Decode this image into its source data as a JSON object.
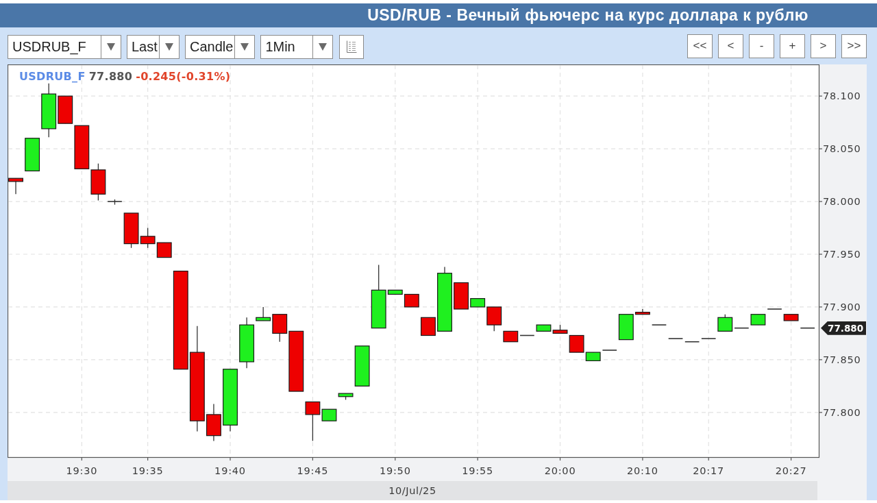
{
  "window": {
    "title": "USD/RUB - Вечный фьючерс на курс доллара к рублю"
  },
  "toolbar": {
    "dropdowns": [
      {
        "value": "USDRUB_F"
      },
      {
        "value": "Last"
      },
      {
        "value": "Candle"
      },
      {
        "value": "1Min"
      }
    ],
    "nav_buttons": [
      "<<",
      "<",
      "-",
      "+",
      ">",
      ">>"
    ]
  },
  "chart": {
    "legend": {
      "symbol": "USDRUB_F",
      "price": "77.880",
      "change": "-0.245(-0.31%)"
    },
    "price_tag": "77.880",
    "chart_data": {
      "type": "candlestick",
      "xlabel": "10/Jul/25",
      "grid": true,
      "categories": [
        null,
        null,
        null,
        null,
        "19:30",
        null,
        null,
        null,
        "19:35",
        null,
        null,
        null,
        null,
        "19:40",
        null,
        null,
        null,
        null,
        "19:45",
        null,
        null,
        null,
        null,
        "19:50",
        null,
        null,
        null,
        null,
        "19:55",
        null,
        null,
        null,
        null,
        "20:00",
        null,
        null,
        null,
        null,
        "20:10",
        null,
        null,
        null,
        "20:17",
        null,
        null,
        null,
        null,
        "20:27",
        null
      ],
      "ohlc": [
        [
          78.022,
          78.022,
          78.007,
          78.019
        ],
        [
          78.029,
          78.06,
          78.029,
          78.06
        ],
        [
          78.069,
          78.112,
          78.061,
          78.102
        ],
        [
          78.1,
          78.1,
          78.074,
          78.074
        ],
        [
          78.072,
          78.072,
          78.031,
          78.031
        ],
        [
          78.03,
          78.036,
          78.001,
          78.007
        ],
        [
          78.0,
          78.002,
          77.997,
          78.0
        ],
        [
          77.989,
          77.989,
          77.956,
          77.96
        ],
        [
          77.967,
          77.975,
          77.956,
          77.96
        ],
        [
          77.961,
          77.961,
          77.947,
          77.947
        ],
        [
          77.934,
          77.934,
          77.841,
          77.841
        ],
        [
          77.857,
          77.882,
          77.782,
          77.792
        ],
        [
          77.798,
          77.808,
          77.773,
          77.778
        ],
        [
          77.788,
          77.841,
          77.782,
          77.841
        ],
        [
          77.848,
          77.89,
          77.842,
          77.883
        ],
        [
          77.887,
          77.9,
          77.887,
          77.89
        ],
        [
          77.893,
          77.893,
          77.867,
          77.875
        ],
        [
          77.877,
          77.877,
          77.82,
          77.82
        ],
        [
          77.81,
          77.81,
          77.773,
          77.798
        ],
        [
          77.792,
          77.803,
          77.792,
          77.803
        ],
        [
          77.815,
          77.818,
          77.812,
          77.818
        ],
        [
          77.825,
          77.863,
          77.825,
          77.863
        ],
        [
          77.88,
          77.94,
          77.88,
          77.916
        ],
        [
          77.912,
          77.916,
          77.912,
          77.916
        ],
        [
          77.912,
          77.912,
          77.9,
          77.9
        ],
        [
          77.89,
          77.89,
          77.873,
          77.873
        ],
        [
          77.877,
          77.938,
          77.877,
          77.932
        ],
        [
          77.923,
          77.923,
          77.898,
          77.898
        ],
        [
          77.9,
          77.908,
          77.9,
          77.908
        ],
        [
          77.9,
          77.9,
          77.877,
          77.883
        ],
        [
          77.877,
          77.877,
          77.867,
          77.867
        ],
        [
          77.873,
          77.873,
          77.873,
          77.873
        ],
        [
          77.877,
          77.883,
          77.877,
          77.883
        ],
        [
          77.878,
          77.883,
          77.875,
          77.875
        ],
        [
          77.873,
          77.873,
          77.857,
          77.857
        ],
        [
          77.849,
          77.857,
          77.849,
          77.857
        ],
        [
          77.859,
          77.859,
          77.859,
          77.859
        ],
        [
          77.869,
          77.893,
          77.869,
          77.893
        ],
        [
          77.895,
          77.898,
          77.893,
          77.893
        ],
        [
          77.883,
          77.883,
          77.883,
          77.883
        ],
        [
          77.87,
          77.87,
          77.87,
          77.87
        ],
        [
          77.867,
          77.867,
          77.867,
          77.867
        ],
        [
          77.87,
          77.87,
          77.87,
          77.87
        ],
        [
          77.877,
          77.893,
          77.877,
          77.89
        ],
        [
          77.88,
          77.88,
          77.88,
          77.88
        ],
        [
          77.883,
          77.893,
          77.883,
          77.893
        ],
        [
          77.898,
          77.898,
          77.898,
          77.898
        ],
        [
          77.893,
          77.893,
          77.887,
          77.887
        ],
        [
          77.88,
          77.88,
          77.88,
          77.88
        ]
      ],
      "ylim": [
        77.757,
        78.13
      ],
      "yticks": [
        {
          "value": 77.8,
          "label": "77.800"
        },
        {
          "value": 77.85,
          "label": "77.850"
        },
        {
          "value": 77.9,
          "label": "77.900"
        },
        {
          "value": 77.95,
          "label": "77.950"
        },
        {
          "value": 78.0,
          "label": "78.000"
        },
        {
          "value": 78.05,
          "label": "78.050"
        },
        {
          "value": 78.1,
          "label": "78.100"
        }
      ]
    }
  }
}
